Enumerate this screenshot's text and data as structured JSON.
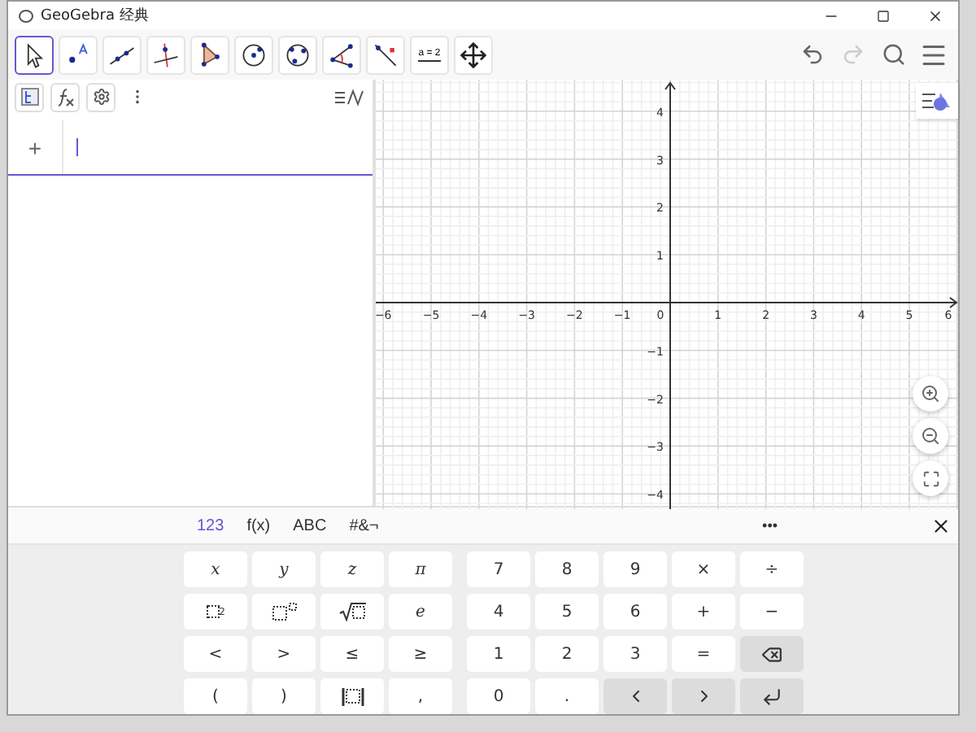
{
  "window": {
    "title": "GeoGebra 经典"
  },
  "tools": [
    {
      "kind": "move",
      "selected": true
    },
    {
      "kind": "point",
      "selected": false
    },
    {
      "kind": "line",
      "selected": false
    },
    {
      "kind": "perpendicular",
      "selected": false
    },
    {
      "kind": "polygon",
      "selected": false
    },
    {
      "kind": "circle",
      "selected": false
    },
    {
      "kind": "conic",
      "selected": false
    },
    {
      "kind": "angle",
      "selected": false
    },
    {
      "kind": "reflect",
      "selected": false
    },
    {
      "kind": "slider",
      "selected": false,
      "label": "a = 2"
    },
    {
      "kind": "pan",
      "selected": false
    }
  ],
  "toolbar_right": [
    {
      "kind": "undo",
      "disabled": false
    },
    {
      "kind": "redo",
      "disabled": true
    },
    {
      "kind": "search",
      "disabled": false
    },
    {
      "kind": "menu",
      "disabled": false
    }
  ],
  "algebra": {
    "input_add": "+",
    "input_focused": true
  },
  "graphics": {
    "x_labels": [
      "−6",
      "−5",
      "−4",
      "−3",
      "−2",
      "−1",
      "0",
      "1",
      "2",
      "3",
      "4",
      "5",
      "6"
    ],
    "y_labels": [
      "4",
      "3",
      "2",
      "1",
      "−1",
      "−2",
      "−3",
      "−4"
    ]
  },
  "keyboard": {
    "tabs": [
      {
        "label": "123",
        "selected": true
      },
      {
        "label": "f(x)",
        "selected": false
      },
      {
        "label": "ABC",
        "selected": false
      },
      {
        "label": "#&¬",
        "selected": false
      }
    ],
    "more": "•••",
    "left_keys": [
      {
        "kind": "italic",
        "label": "x"
      },
      {
        "kind": "italic",
        "label": "y"
      },
      {
        "kind": "italic",
        "label": "z"
      },
      {
        "kind": "italic",
        "label": "π"
      },
      {
        "kind": "square",
        "label": "2"
      },
      {
        "kind": "power"
      },
      {
        "kind": "sqrt"
      },
      {
        "kind": "italic",
        "label": "e"
      },
      {
        "kind": "text",
        "label": "<"
      },
      {
        "kind": "text",
        "label": ">"
      },
      {
        "kind": "text",
        "label": "≤"
      },
      {
        "kind": "text",
        "label": "≥"
      },
      {
        "kind": "text",
        "label": "("
      },
      {
        "kind": "text",
        "label": ")"
      },
      {
        "kind": "abs"
      },
      {
        "kind": "text",
        "label": ","
      }
    ],
    "right_keys": [
      {
        "kind": "text",
        "label": "7"
      },
      {
        "kind": "text",
        "label": "8"
      },
      {
        "kind": "text",
        "label": "9"
      },
      {
        "kind": "text",
        "label": "×"
      },
      {
        "kind": "text",
        "label": "÷"
      },
      {
        "kind": "text",
        "label": "4"
      },
      {
        "kind": "text",
        "label": "5"
      },
      {
        "kind": "text",
        "label": "6"
      },
      {
        "kind": "text",
        "label": "+"
      },
      {
        "kind": "text",
        "label": "−"
      },
      {
        "kind": "text",
        "label": "1"
      },
      {
        "kind": "text",
        "label": "2"
      },
      {
        "kind": "text",
        "label": "3"
      },
      {
        "kind": "text",
        "label": "="
      },
      {
        "kind": "backspace"
      },
      {
        "kind": "text",
        "label": "0"
      },
      {
        "kind": "text",
        "label": "."
      },
      {
        "kind": "left"
      },
      {
        "kind": "right"
      },
      {
        "kind": "enter"
      }
    ]
  }
}
